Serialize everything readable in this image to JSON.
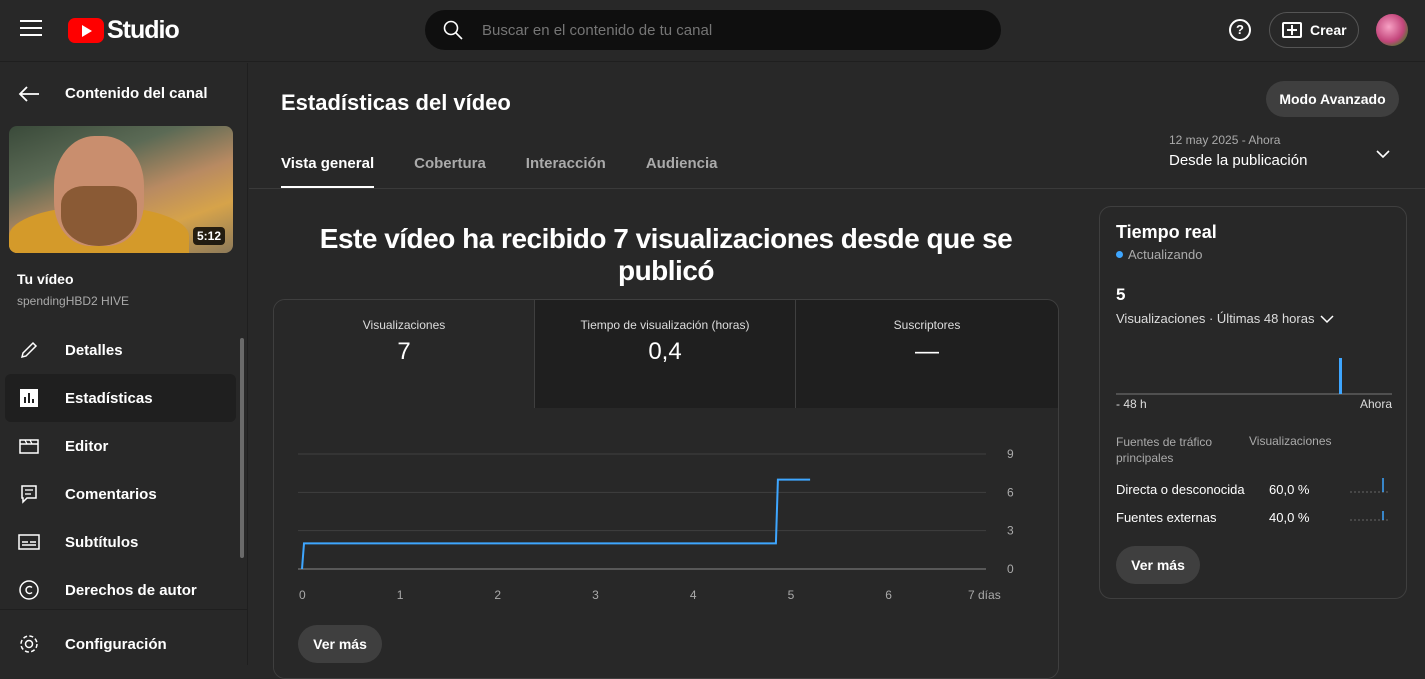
{
  "app": {
    "logo_text": "Studio"
  },
  "search": {
    "placeholder": "Buscar en el contenido de tu canal"
  },
  "header": {
    "help_glyph": "?",
    "create_label": "Crear"
  },
  "sidebar": {
    "back_label": "Contenido del canal",
    "video_duration": "5:12",
    "your_video_label": "Tu vídeo",
    "channel_name": "spendingHBD2 HIVE",
    "items": [
      {
        "label": "Detalles",
        "icon": "pencil-icon",
        "active": false
      },
      {
        "label": "Estadísticas",
        "icon": "analytics-icon",
        "active": true
      },
      {
        "label": "Editor",
        "icon": "clapper-icon",
        "active": false
      },
      {
        "label": "Comentarios",
        "icon": "comment-icon",
        "active": false
      },
      {
        "label": "Subtítulos",
        "icon": "subtitles-icon",
        "active": false
      },
      {
        "label": "Derechos de autor",
        "icon": "copyright-icon",
        "active": false
      }
    ],
    "settings_label": "Configuración"
  },
  "main": {
    "title": "Estadísticas del vídeo",
    "advanced_mode_label": "Modo Avanzado",
    "tabs": [
      {
        "label": "Vista general",
        "active": true
      },
      {
        "label": "Cobertura",
        "active": false
      },
      {
        "label": "Interacción",
        "active": false
      },
      {
        "label": "Audiencia",
        "active": false
      }
    ],
    "date_range": {
      "dates": "12 may 2025 - Ahora",
      "label": "Desde la publicación"
    },
    "headline": "Este vídeo ha recibido 7 visualizaciones desde que se publicó",
    "metrics": [
      {
        "label": "Visualizaciones",
        "value": "7"
      },
      {
        "label": "Tiempo de visualización (horas)",
        "value": "0,4"
      },
      {
        "label": "Suscriptores",
        "value": "—"
      }
    ],
    "see_more_label": "Ver más"
  },
  "chart_data": {
    "type": "line",
    "x_ticks": [
      "0",
      "1",
      "2",
      "3",
      "4",
      "5",
      "6",
      "7 días"
    ],
    "y_ticks": [
      "0",
      "3",
      "6",
      "9"
    ],
    "ylim": [
      0,
      9
    ],
    "xlim": [
      0,
      7
    ],
    "series": [
      {
        "points": [
          [
            0,
            0
          ],
          [
            0.02,
            2
          ],
          [
            4.85,
            2
          ],
          [
            4.87,
            7
          ],
          [
            5.2,
            7
          ]
        ],
        "color": "#3ea6ff"
      }
    ]
  },
  "realtime": {
    "title": "Tiempo real",
    "status": "Actualizando",
    "count": "5",
    "subtitle": "Visualizaciones · Últimas 48 horas",
    "axis_start": "- 48 h",
    "axis_end": "Ahora",
    "sources_header": "Fuentes de tráfico principales",
    "views_header": "Visualizaciones",
    "sources": [
      {
        "name": "Directa o desconocida",
        "percent": "60,0 %"
      },
      {
        "name": "Fuentes externas",
        "percent": "40,0 %"
      }
    ],
    "see_more_label": "Ver más",
    "accent": "#3ea6ff"
  }
}
